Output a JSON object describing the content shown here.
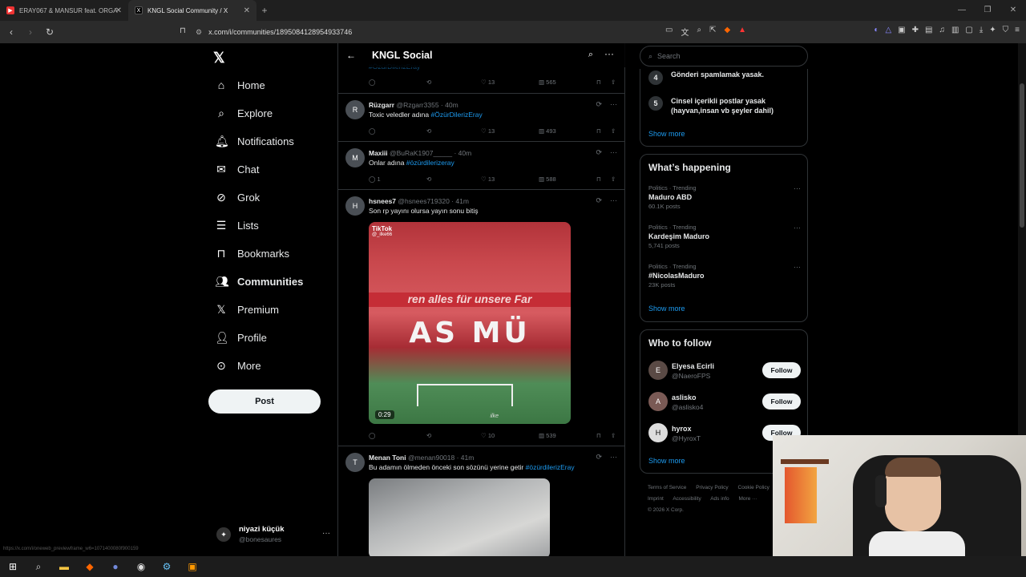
{
  "browser": {
    "tabs": [
      {
        "title": "ERAY067 & MANSUR feat. ORGA",
        "active": false
      },
      {
        "title": "KNGL Social Community / X",
        "active": true
      }
    ],
    "url": "x.com/i/communities/1895084128954933746",
    "status_url": "https://x.com/i/oneweb_previewframe_w6=1071400080f900159"
  },
  "nav": {
    "items": [
      {
        "label": "Home",
        "icon": "home-icon"
      },
      {
        "label": "Explore",
        "icon": "search-icon"
      },
      {
        "label": "Notifications",
        "icon": "bell-icon"
      },
      {
        "label": "Chat",
        "icon": "mail-icon"
      },
      {
        "label": "Grok",
        "icon": "grok-icon"
      },
      {
        "label": "Lists",
        "icon": "list-icon"
      },
      {
        "label": "Bookmarks",
        "icon": "bookmark-icon"
      },
      {
        "label": "Communities",
        "icon": "people-icon"
      },
      {
        "label": "Premium",
        "icon": "x-icon"
      },
      {
        "label": "Profile",
        "icon": "person-icon"
      },
      {
        "label": "More",
        "icon": "more-circle-icon"
      }
    ],
    "post_label": "Post",
    "profile": {
      "name": "niyazi küçük",
      "handle": "@bonesaures"
    }
  },
  "community": {
    "title": "KNGL Social",
    "hashtag_top": "#ÖzürDilerizEray"
  },
  "tweets": [
    {
      "name": "Rüzgarr",
      "handle": "@Rzgarr3355",
      "time": "40m",
      "text": "Toxic veledler adına ",
      "tag": "#ÖzürDilerizEray",
      "replies": "",
      "likes": "13",
      "views": "493"
    },
    {
      "name": "Maxiii",
      "handle": "@BuRaK1907_____",
      "time": "40m",
      "text": "Onlar adına ",
      "tag": "#özürdilerizeray",
      "replies": "1",
      "likes": "13",
      "views": "588"
    },
    {
      "name": "hsnees7",
      "handle": "@hsnees719320",
      "time": "41m",
      "text": "Son rp yayını olursa yayın sonu bitiş",
      "tag": "",
      "replies": "",
      "likes": "10",
      "views": "539",
      "video": {
        "brand": "TikTok",
        "user": "@_ilke66",
        "banner": "ren alles für unsere Far",
        "big": "AS MÜ",
        "duration": "0:29",
        "watermark": "ilke"
      }
    },
    {
      "name": "Menan Toni",
      "handle": "@menan90018",
      "time": "41m",
      "text": "Bu adamın ölmeden önceki son  sözünü yerine getir ",
      "tag": "#özürdilerizEray"
    }
  ],
  "top_actions": {
    "likes": "13",
    "views": "565"
  },
  "right": {
    "search_placeholder": "Search",
    "rules": [
      {
        "num": "4",
        "text": "Gönderi spamlamak yasak."
      },
      {
        "num": "5",
        "text": "Cinsel içerikli postlar yasak (hayvan,insan vb şeyler dahil)"
      }
    ],
    "show_more": "Show more",
    "happening_title": "What’s happening",
    "trends": [
      {
        "category": "Politics · Trending",
        "name": "Maduro ABD",
        "posts": "60.1K posts"
      },
      {
        "category": "Politics · Trending",
        "name": "Kardeşim Maduro",
        "posts": "5,741 posts"
      },
      {
        "category": "Politics · Trending",
        "name": "#NicolasMaduro",
        "posts": "23K posts"
      }
    ],
    "who_title": "Who to follow",
    "follow_label": "Follow",
    "follows": [
      {
        "name": "Elyesa Ecirli",
        "handle": "@NaeroFPS"
      },
      {
        "name": "aslisko",
        "handle": "@aslisko4"
      },
      {
        "name": "hyrox",
        "handle": "@HyroxT"
      }
    ],
    "footer": [
      "Terms of Service",
      "Privacy Policy",
      "Cookie Policy",
      "Imprint",
      "Accessibility",
      "Ads info",
      "More ···",
      "© 2026 X Corp."
    ]
  }
}
